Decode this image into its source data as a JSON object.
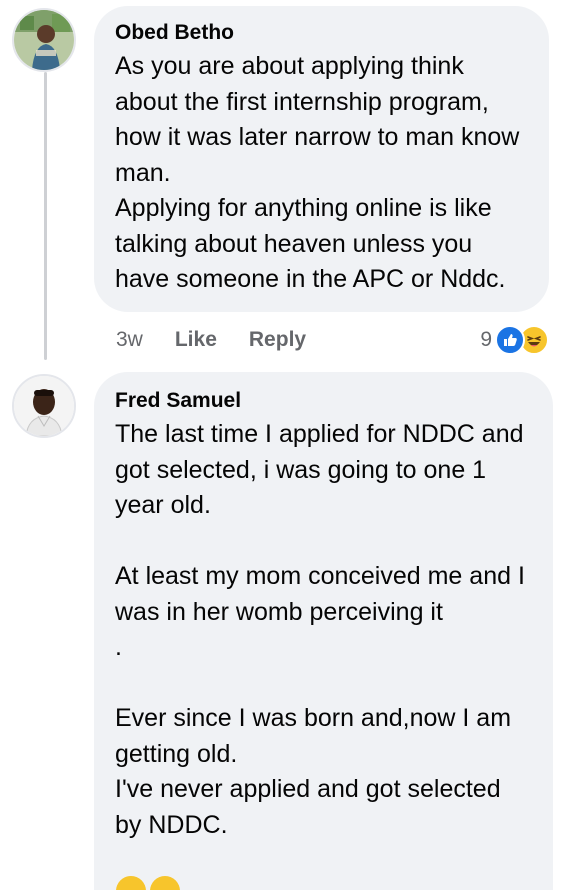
{
  "comments": [
    {
      "author": "Obed Betho",
      "text": "As you are about applying think about the first internship program, how it was later narrow to man know man.\nApplying for anything online is like talking about heaven unless you have someone in the APC or Nddc.",
      "time": "3w",
      "like_label": "Like",
      "reply_label": "Reply",
      "reaction_count": "9",
      "reactions": [
        "like-icon",
        "haha-icon"
      ],
      "colors": {
        "like": "#1b74e4",
        "haha": "#f7c52c"
      }
    },
    {
      "author": "Fred Samuel",
      "text": "The last time I applied for NDDC and got selected, i was going to one 1 year old.\n\nAt least my mom conceived me and I was in her womb perceiving it\n.\n\nEver since I was born and,now I am getting old.\nI've never applied and got selected by NDDC."
    }
  ],
  "colors": {
    "bubble_bg": "#f0f2f5",
    "meta_text": "#65676b",
    "thread_line": "#ced0d4"
  }
}
